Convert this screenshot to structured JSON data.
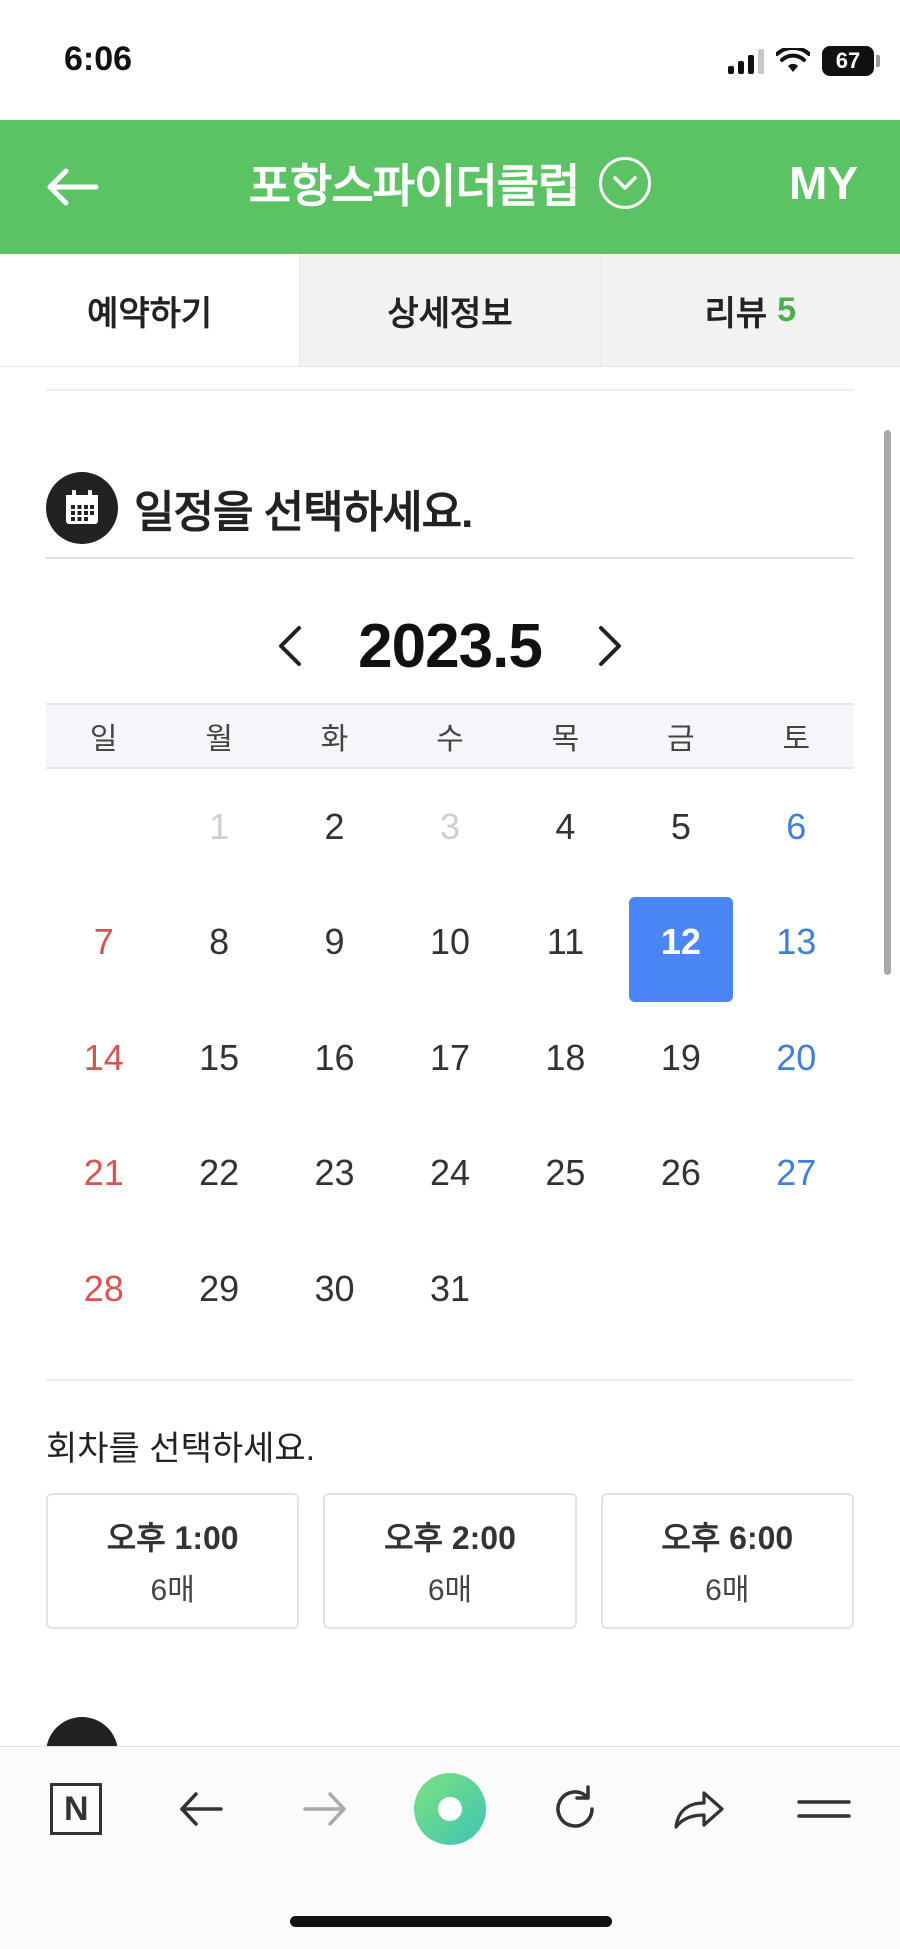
{
  "status_bar": {
    "time": "6:06",
    "battery": "67"
  },
  "header": {
    "title": "포항스파이더클럽",
    "my_label": "MY"
  },
  "tabs": [
    {
      "label": "예약하기",
      "active": true
    },
    {
      "label": "상세정보"
    },
    {
      "label": "리뷰",
      "count": "5"
    }
  ],
  "schedule": {
    "title": "일정을 선택하세요.",
    "month": "2023.5",
    "weekdays": [
      "일",
      "월",
      "화",
      "수",
      "목",
      "금",
      "토"
    ],
    "days": [
      [
        null,
        {
          "d": "1",
          "state": "disabled"
        },
        {
          "d": "2"
        },
        {
          "d": "3",
          "state": "disabled"
        },
        {
          "d": "4"
        },
        {
          "d": "5"
        },
        {
          "d": "6"
        }
      ],
      [
        {
          "d": "7"
        },
        {
          "d": "8"
        },
        {
          "d": "9"
        },
        {
          "d": "10"
        },
        {
          "d": "11"
        },
        {
          "d": "12",
          "state": "selected"
        },
        {
          "d": "13"
        }
      ],
      [
        {
          "d": "14"
        },
        {
          "d": "15"
        },
        {
          "d": "16"
        },
        {
          "d": "17"
        },
        {
          "d": "18"
        },
        {
          "d": "19"
        },
        {
          "d": "20"
        }
      ],
      [
        {
          "d": "21"
        },
        {
          "d": "22"
        },
        {
          "d": "23"
        },
        {
          "d": "24"
        },
        {
          "d": "25"
        },
        {
          "d": "26"
        },
        {
          "d": "27"
        }
      ],
      [
        {
          "d": "28"
        },
        {
          "d": "29"
        },
        {
          "d": "30"
        },
        {
          "d": "31"
        },
        null,
        null,
        null
      ]
    ]
  },
  "rounds": {
    "title": "회차를 선택하세요.",
    "items": [
      {
        "time": "오후 1:00",
        "seats": "6매"
      },
      {
        "time": "오후 2:00",
        "seats": "6매"
      },
      {
        "time": "오후 6:00",
        "seats": "6매"
      }
    ]
  },
  "colors": {
    "header_green": "#5bc364",
    "selected_blue": "#4a86f5",
    "sunday_red": "#d9534f",
    "saturday_blue": "#3f7fdc"
  }
}
